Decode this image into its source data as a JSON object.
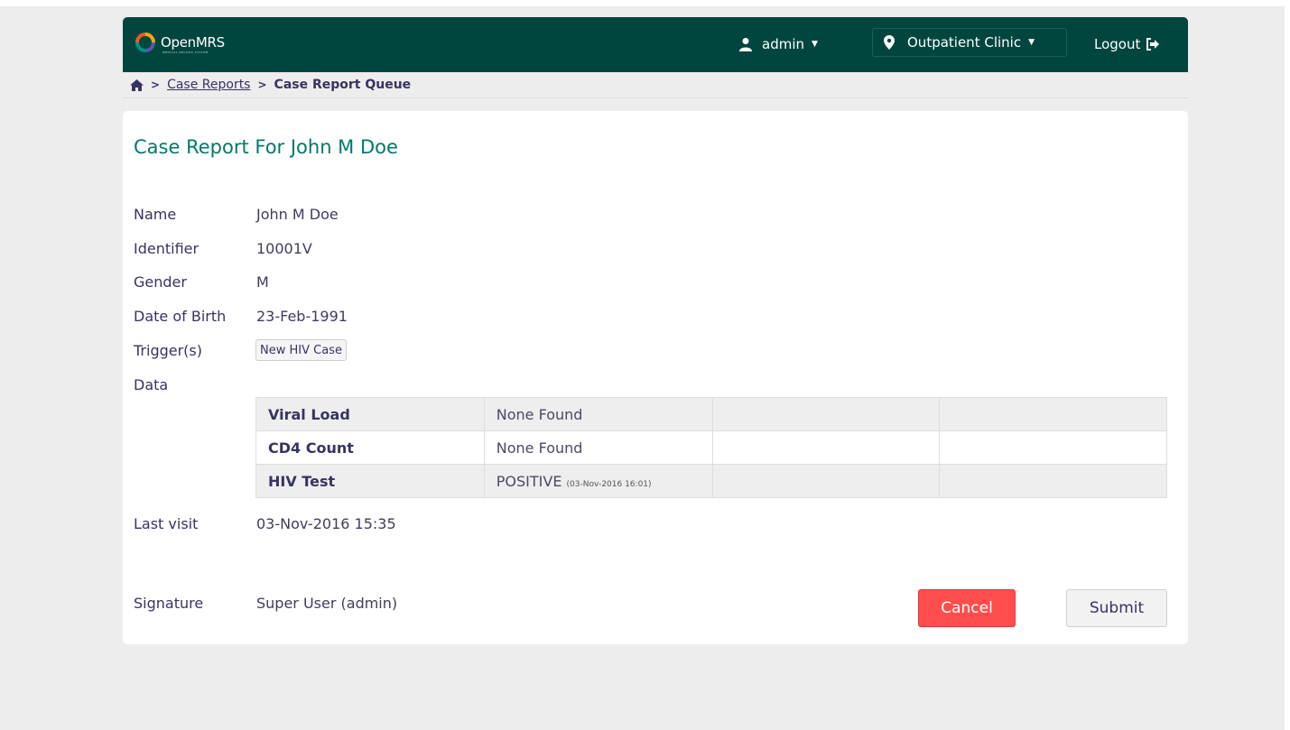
{
  "header": {
    "brand": "OpenMRS",
    "brand_subtitle": "MEDICAL RECORD SYSTEM",
    "user": "admin",
    "location": "Outpatient Clinic",
    "logout": "Logout"
  },
  "breadcrumb": {
    "link": "Case Reports",
    "current": "Case Report Queue"
  },
  "page": {
    "title": "Case Report For John M Doe"
  },
  "fields": {
    "name_label": "Name",
    "name_value": "John M Doe",
    "identifier_label": "Identifier",
    "identifier_value": "10001V",
    "gender_label": "Gender",
    "gender_value": "M",
    "dob_label": "Date of Birth",
    "dob_value": "23-Feb-1991",
    "triggers_label": "Trigger(s)",
    "trigger_button": "New HIV Case",
    "data_label": "Data",
    "last_visit_label": "Last visit",
    "last_visit_value": "03-Nov-2016 15:35",
    "signature_label": "Signature",
    "signature_value": "Super User (admin)"
  },
  "data_table": {
    "rows": [
      {
        "name": "Viral Load",
        "value": "None Found",
        "date": ""
      },
      {
        "name": "CD4 Count",
        "value": "None Found",
        "date": ""
      },
      {
        "name": "HIV Test",
        "value": "POSITIVE",
        "date": "(03-Nov-2016 16:01)"
      }
    ]
  },
  "actions": {
    "cancel": "Cancel",
    "submit": "Submit"
  },
  "colors": {
    "header_bg": "#00463f",
    "title": "#00796b",
    "cancel": "#ff4d4d"
  }
}
